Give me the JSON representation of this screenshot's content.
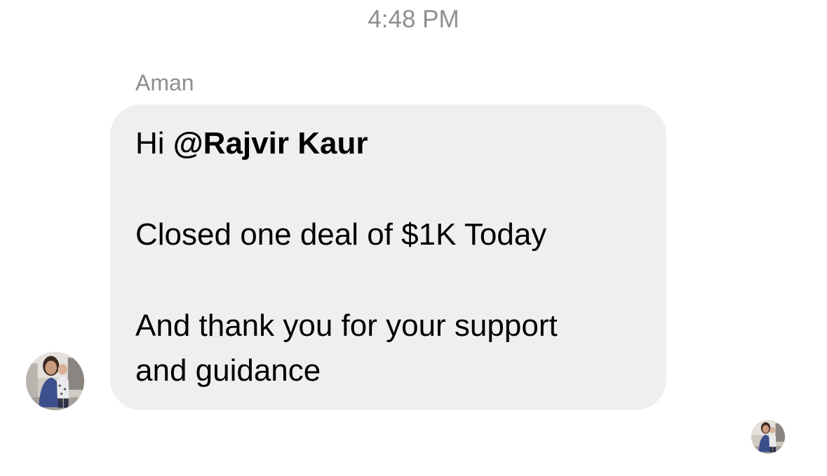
{
  "conversation": {
    "timestamp": "4:48 PM"
  },
  "message": {
    "sender": "Aman",
    "greeting_prefix": "Hi ",
    "mention": "@Rajvir Kaur",
    "line2": "Closed one deal of $1K Today",
    "line3a": "And thank you for your support",
    "line3b": "and guidance"
  },
  "colors": {
    "bubble_background": "#efefef",
    "meta_text": "#8e8e93",
    "message_text": "#000000"
  },
  "icons": {
    "sender_avatar": "sender-avatar-photo",
    "read_receipt_avatar": "read-receipt-avatar-photo"
  }
}
